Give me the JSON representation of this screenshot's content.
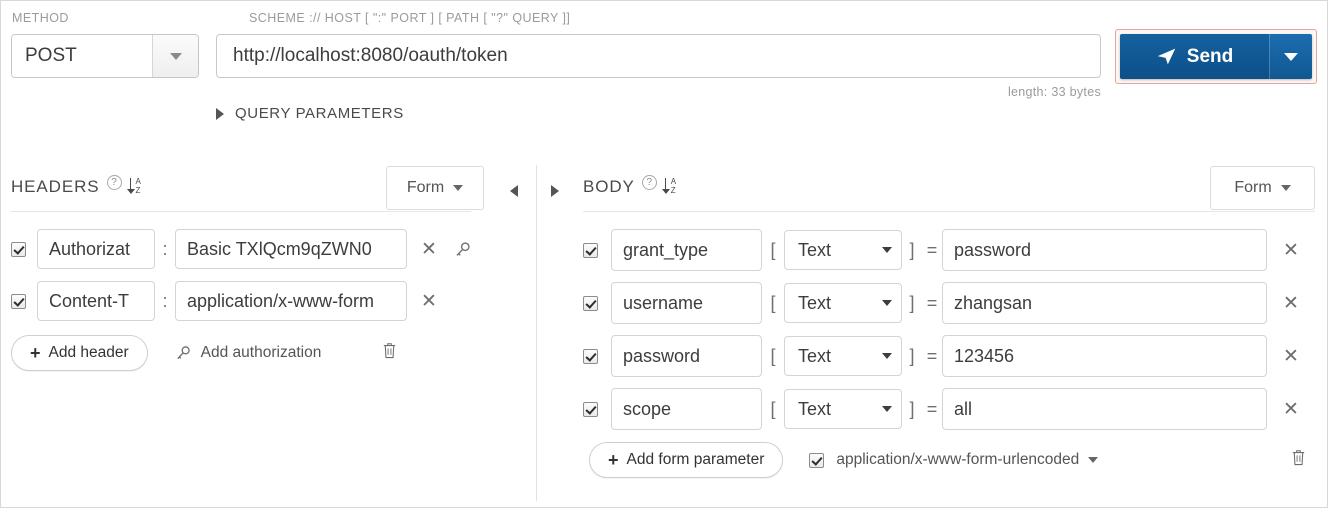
{
  "request": {
    "method_caption": "METHOD",
    "url_caption": "SCHEME :// HOST [ \":\" PORT ] [ PATH [ \"?\" QUERY ]]",
    "method": "POST",
    "url": "http://localhost:8080/oauth/token",
    "length_note": "length: 33 bytes",
    "send_label": "Send",
    "send_icon": "paper-plane-icon",
    "query_parameters_label": "QUERY PARAMETERS"
  },
  "headers_pane": {
    "title": "HEADERS",
    "help_icon": "?",
    "sort_icon": "sort-az-icon",
    "view_mode": "Form",
    "collapse_icon": "chevron-left-icon",
    "rows": [
      {
        "enabled": true,
        "name": "Authorizat",
        "separator": ":",
        "value": "Basic TXlQcm9qZWN0",
        "has_key_action": true
      },
      {
        "enabled": true,
        "name": "Content-T",
        "separator": ":",
        "value": "application/x-www-form",
        "has_key_action": false
      }
    ],
    "add_header_label": "Add header",
    "add_authorization_label": "Add authorization",
    "delete_icon": "trash-icon"
  },
  "body_pane": {
    "expand_icon": "chevron-right-icon",
    "title": "BODY",
    "help_icon": "?",
    "sort_icon": "sort-az-icon",
    "view_mode": "Form",
    "bracket_open": "[",
    "bracket_close": "]",
    "equals": "=",
    "rows": [
      {
        "enabled": true,
        "name": "grant_type",
        "type": "Text",
        "value": "password"
      },
      {
        "enabled": true,
        "name": "username",
        "type": "Text",
        "value": "zhangsan"
      },
      {
        "enabled": true,
        "name": "password",
        "type": "Text",
        "value": "123456"
      },
      {
        "enabled": true,
        "name": "scope",
        "type": "Text",
        "value": "all"
      }
    ],
    "add_form_parameter_label": "Add form parameter",
    "content_type_enabled": true,
    "content_type": "application/x-www-form-urlencoded",
    "delete_icon": "trash-icon"
  },
  "colors": {
    "send_blue": "#0d4f89",
    "focus_outline": "#e0a89a",
    "caption_gray": "#9b9b9b",
    "border_gray": "#d4d4d4"
  }
}
